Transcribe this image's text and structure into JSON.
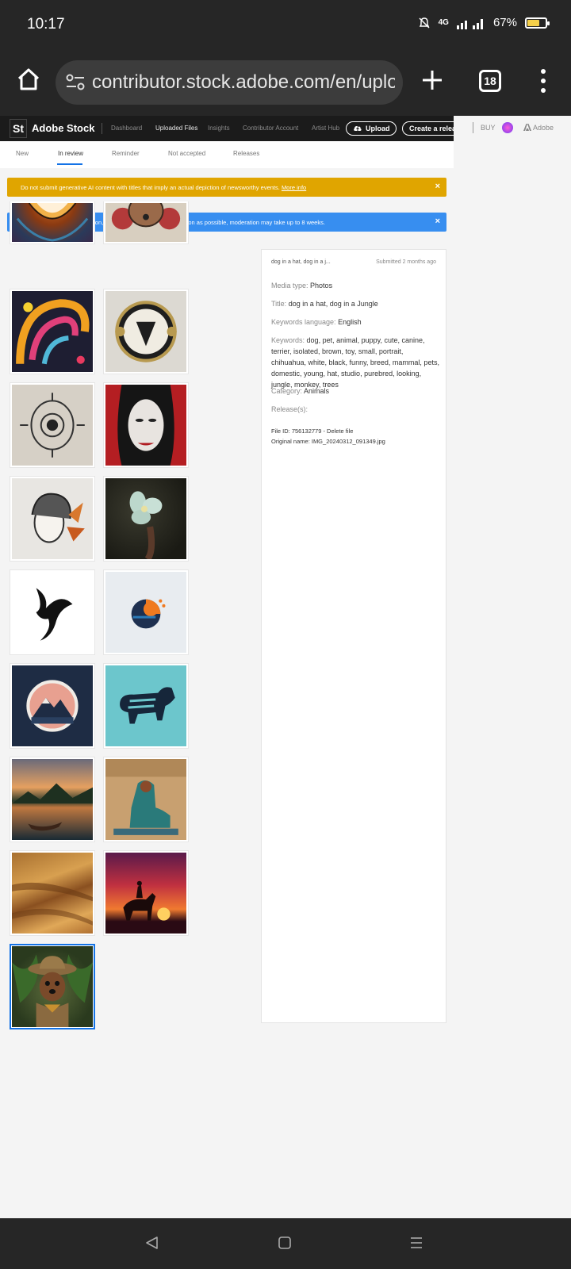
{
  "status_bar": {
    "time": "10:17",
    "network": "4G",
    "battery": "67%",
    "battery_level": 0.67
  },
  "browser": {
    "url": "contributor.stock.adobe.com/en/uplo",
    "tab_count": "18"
  },
  "site": {
    "brand_logo": "St",
    "brand_name": "Adobe Stock",
    "nav": [
      "Dashboard",
      "Uploaded Files",
      "Insights",
      "Contributor Account",
      "Artist Hub"
    ],
    "active_nav": "Uploaded Files",
    "upload_label": "Upload",
    "create_release_label": "Create a release",
    "buy_label": "BUY",
    "adobe_label": "Adobe"
  },
  "tabs": {
    "items": [
      "New",
      "In review",
      "Reminder",
      "Not accepted",
      "Releases"
    ],
    "active": "In review"
  },
  "alerts": {
    "warning": "Do not submit generative AI content with titles that imply an actual depiction of newsworthy events.",
    "warning_link": "More info",
    "info": "Thank you for your submission, your files will be reviewed as soon as possible, moderation may take up to 8 weeks.",
    "close": "×"
  },
  "thumbnails": [
    "tiger-head-illustration",
    "floral-dog-illustration",
    "colorful-swirl-art",
    "emblem-logo",
    "ornamental-eye-drawing",
    "woman-portrait-red",
    "woman-portrait-sketch",
    "white-flower-photo",
    "bird-logo",
    "moon-sun-logo",
    "mountain-badge-logo",
    "bull-logo",
    "lake-boat-sunset",
    "egyptian-mural",
    "desert-dunes",
    "horse-rider-sunset",
    "dog-in-hat-jungle"
  ],
  "detail": {
    "header_title": "dog in a hat, dog in a j...",
    "submitted": "Submitted 2 months ago",
    "media_type_label": "Media type:",
    "media_type": "Photos",
    "title_label": "Title:",
    "title": "dog in a hat, dog in a Jungle",
    "kw_lang_label": "Keywords language:",
    "kw_lang": "English",
    "keywords_label": "Keywords:",
    "keywords": "dog, pet, animal, puppy, cute, canine, terrier, isolated, brown, toy, small, portrait, chihuahua, white, black, funny, breed, mammal, pets, domestic, young, hat, studio, purebred, looking, jungle, monkey, trees",
    "category_label": "Category:",
    "category": "Animals",
    "releases_label": "Release(s):",
    "file_id": "File ID: 756132779 - Delete file",
    "original_name": "Original name: IMG_20240312_091349.jpg"
  }
}
